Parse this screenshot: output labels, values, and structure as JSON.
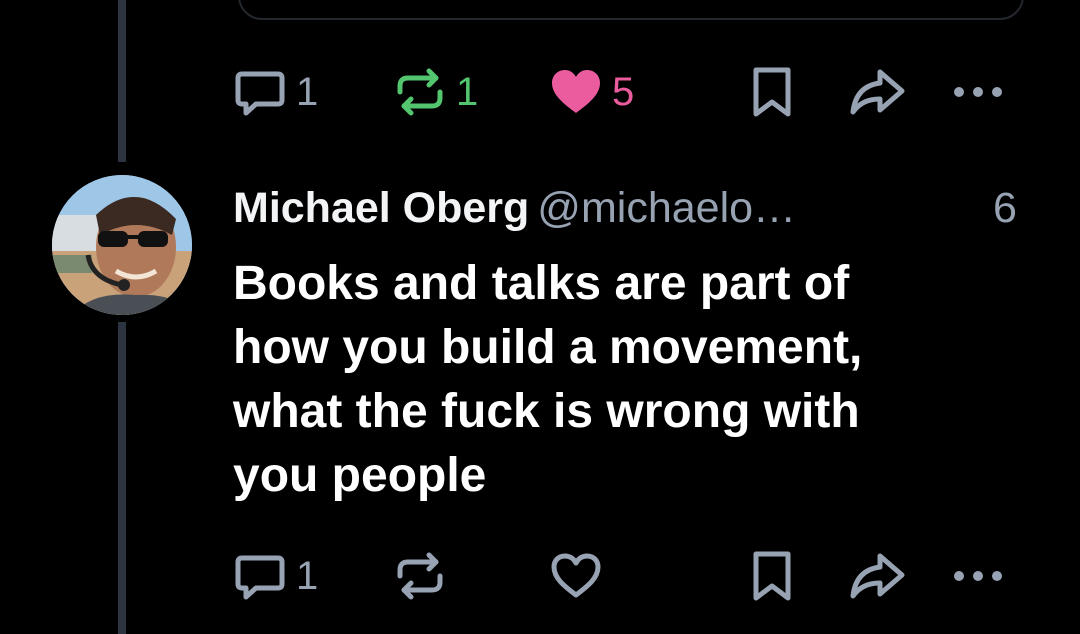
{
  "parent_post": {
    "actions": {
      "reply_count": "1",
      "repost_count": "1",
      "like_count": "5",
      "liked": true,
      "reposted": true
    }
  },
  "reply_post": {
    "author": {
      "display_name": "Michael Oberg",
      "handle": "@michaelo…"
    },
    "timestamp": "6",
    "text_lines": [
      "Books and talks are part of",
      "how you build a movement,",
      "what the fuck is wrong with",
      "you people"
    ],
    "actions": {
      "reply_count": "1",
      "repost_count": "",
      "like_count": "",
      "liked": false,
      "reposted": false
    }
  },
  "colors": {
    "background": "#000000",
    "icon_grey": "#97a3b3",
    "repost_green": "#53c56f",
    "like_pink": "#ea5c9d",
    "thread_line": "#2b3440"
  },
  "icons": [
    "reply-icon",
    "repost-icon",
    "like-icon",
    "bookmark-icon",
    "share-icon",
    "more-icon"
  ]
}
